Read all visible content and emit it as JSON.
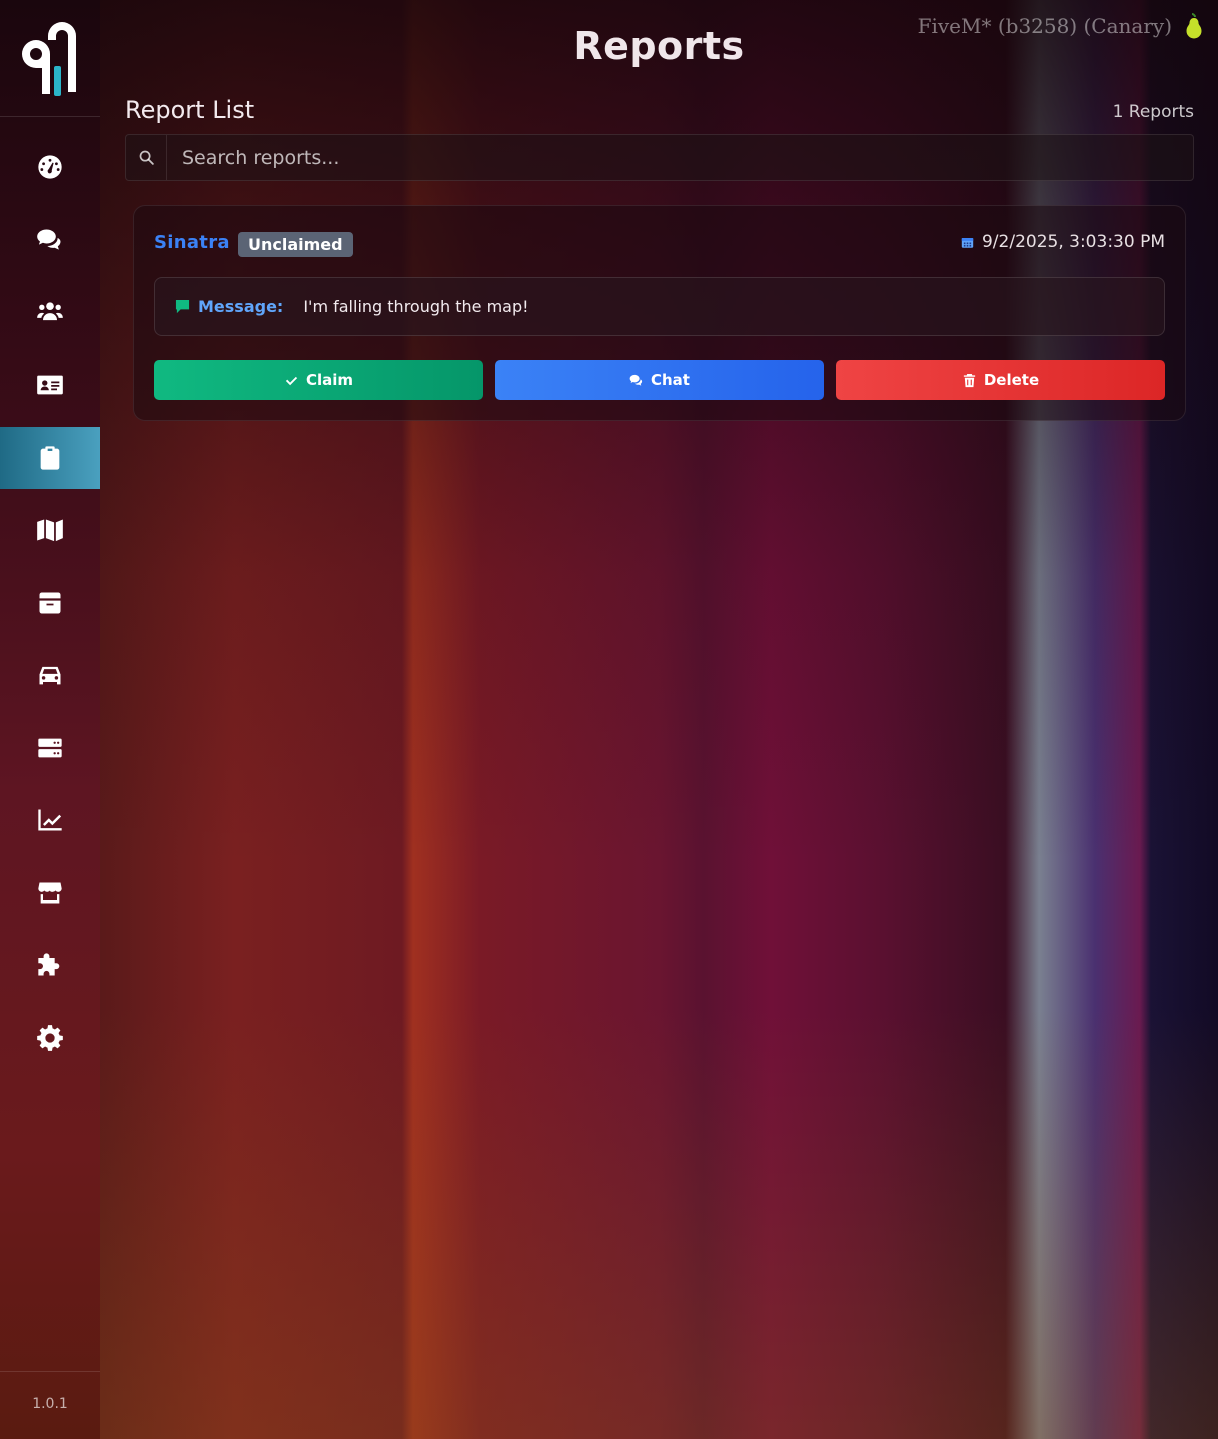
{
  "app": {
    "title": "Reports",
    "server_info": "FiveM* (b3258) (Canary)",
    "version": "1.0.1"
  },
  "sidebar": {
    "items": [
      {
        "icon": "dashboard-icon",
        "active": false
      },
      {
        "icon": "chat-icon",
        "active": false
      },
      {
        "icon": "users-icon",
        "active": false
      },
      {
        "icon": "id-card-icon",
        "active": false
      },
      {
        "icon": "clipboard-icon",
        "active": true
      },
      {
        "icon": "map-icon",
        "active": false
      },
      {
        "icon": "box-icon",
        "active": false
      },
      {
        "icon": "car-icon",
        "active": false
      },
      {
        "icon": "server-icon",
        "active": false
      },
      {
        "icon": "chart-icon",
        "active": false
      },
      {
        "icon": "store-icon",
        "active": false
      },
      {
        "icon": "puzzle-icon",
        "active": false
      },
      {
        "icon": "gear-icon",
        "active": false
      }
    ]
  },
  "report_list": {
    "title": "Report List",
    "count_label": "1 Reports",
    "search_placeholder": "Search reports..."
  },
  "reports": [
    {
      "player": "Sinatra",
      "status": "Unclaimed",
      "timestamp": "9/2/2025, 3:03:30 PM",
      "message_label": "Message:",
      "message": "I'm falling through the map!",
      "actions": {
        "claim": "Claim",
        "chat": "Chat",
        "delete": "Delete"
      }
    }
  ],
  "colors": {
    "active_nav": "#3b9abb",
    "player_name": "#3b82f6",
    "badge": "#5b6475",
    "claim": "#10b981",
    "chat": "#3b82f6",
    "delete": "#ef4444"
  }
}
